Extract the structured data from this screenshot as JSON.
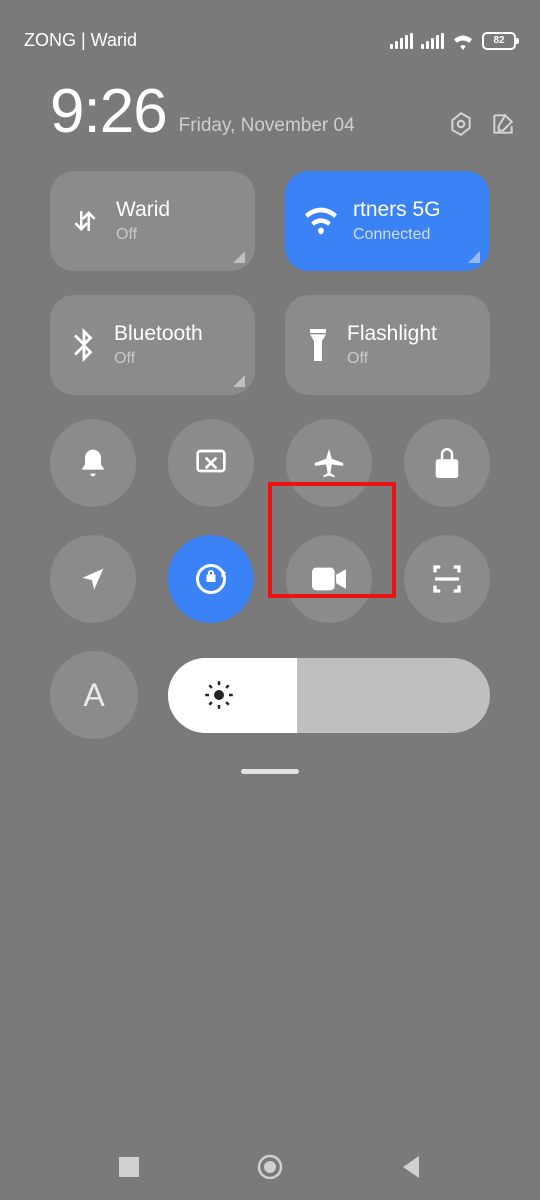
{
  "status": {
    "carrier": "ZONG | Warid",
    "battery": "82"
  },
  "clock": {
    "time": "9:26",
    "date": "Friday, November 04"
  },
  "tiles": {
    "mobile_data": {
      "label": "Warid",
      "sub": "Off"
    },
    "wifi": {
      "label": "rtners 5G",
      "sub": "Connected"
    },
    "bluetooth": {
      "label": "Bluetooth",
      "sub": "Off"
    },
    "flashlight": {
      "label": "Flashlight",
      "sub": "Off"
    }
  },
  "toggles": {
    "sound": "sound",
    "screenshot": "screenshot",
    "airplane": "airplane",
    "lock": "lock",
    "location": "location",
    "autorotate": "autorotate",
    "screenrecord": "screenrecord",
    "scanner": "scanner",
    "auto_brightness": "A"
  },
  "brightness_percent": 40
}
